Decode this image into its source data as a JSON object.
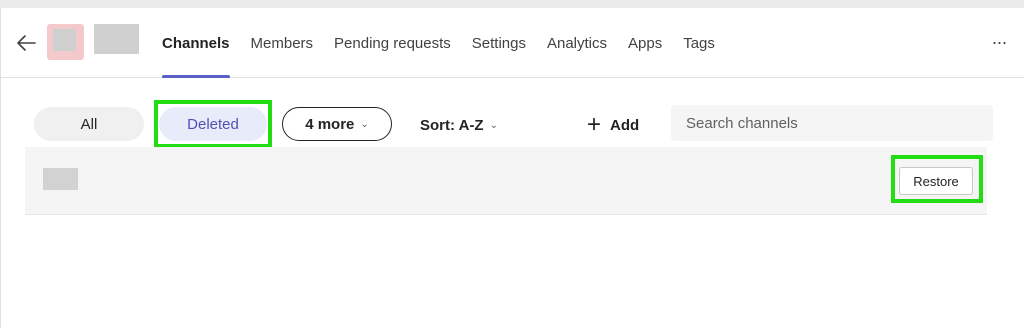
{
  "header": {
    "back_icon": "arrow-left-icon",
    "tabs": [
      {
        "label": "Channels",
        "active": true
      },
      {
        "label": "Members",
        "active": false
      },
      {
        "label": "Pending requests",
        "active": false
      },
      {
        "label": "Settings",
        "active": false
      },
      {
        "label": "Analytics",
        "active": false
      },
      {
        "label": "Apps",
        "active": false
      },
      {
        "label": "Tags",
        "active": false
      }
    ],
    "more_label": "···"
  },
  "filters": {
    "all_label": "All",
    "deleted_label": "Deleted",
    "more_label": "4 more",
    "sort_label": "Sort: A-Z",
    "add_label": "Add"
  },
  "search": {
    "placeholder": "Search channels",
    "value": ""
  },
  "channels": {
    "restore_label": "Restore"
  },
  "colors": {
    "accent": "#5b5fc7",
    "highlight": "#22dd11"
  }
}
